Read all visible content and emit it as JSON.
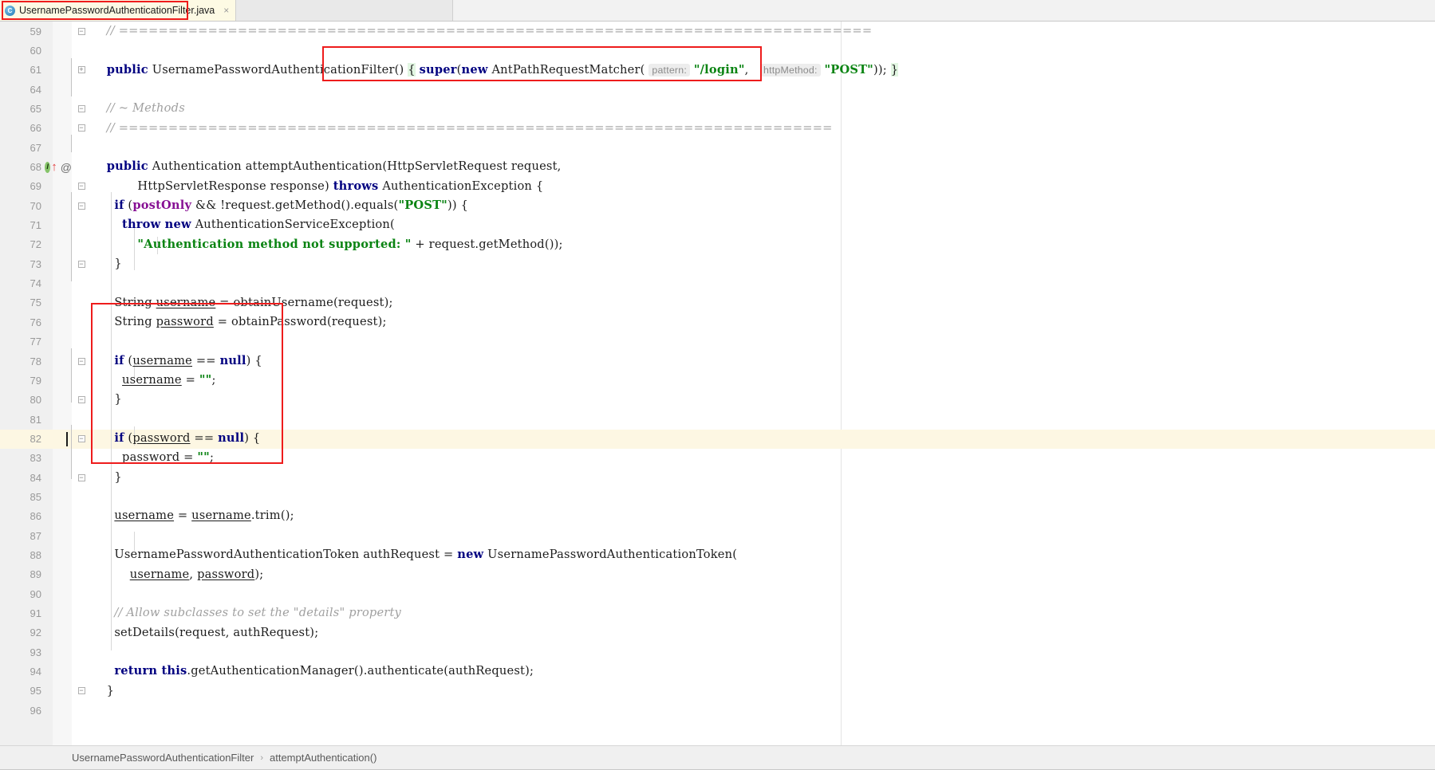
{
  "window": {
    "tab": {
      "filename": "UsernamePasswordAuthenticationFilter.java",
      "icon": "java-class-icon",
      "close_label": "×"
    }
  },
  "breadcrumb": {
    "items": [
      "UsernamePasswordAuthenticationFilter",
      "attemptAuthentication()"
    ],
    "separator": "›"
  },
  "editor": {
    "annotations": [
      {
        "name": "tab-highlight-box",
        "color": "#ee1c1c"
      },
      {
        "name": "constructor-highlight-box",
        "color": "#ee1c1c"
      },
      {
        "name": "null-check-highlight-box",
        "color": "#ee1c1c"
      }
    ],
    "caret_line": 81,
    "caret_line_color": "#fdf7e3",
    "colors": {
      "keyword": "#000080",
      "string": "#0b8413",
      "comment": "#a0a0a0",
      "field": "#871094",
      "hint_bg": "#ededed",
      "gutter_bg": "#f0f0f0"
    },
    "lines": [
      {
        "n": "59",
        "fold": "minus",
        "segments": [
          {
            "t": "  // ============================================================================",
            "c": "cmt"
          }
        ]
      },
      {
        "n": "60",
        "segments": []
      },
      {
        "n": "61",
        "fold": "plus",
        "segments": [
          {
            "t": "  ",
            "c": ""
          },
          {
            "t": "public",
            "c": "kw"
          },
          {
            "t": " UsernamePasswordAuthenticationFilter() ",
            "c": ""
          },
          {
            "t": "{",
            "c": "hl-brace"
          },
          {
            "t": " ",
            "c": ""
          },
          {
            "t": "super",
            "c": "kw"
          },
          {
            "t": "(",
            "c": ""
          },
          {
            "t": "new",
            "c": "kw"
          },
          {
            "t": " AntPathRequestMatcher( ",
            "c": ""
          },
          {
            "t": "pattern:",
            "c": "hint"
          },
          {
            "t": " ",
            "c": ""
          },
          {
            "t": "\"/login\"",
            "c": "str"
          },
          {
            "t": ",   ",
            "c": ""
          },
          {
            "t": "httpMethod:",
            "c": "hint"
          },
          {
            "t": " ",
            "c": ""
          },
          {
            "t": "\"POST\"",
            "c": "str"
          },
          {
            "t": ")); ",
            "c": ""
          },
          {
            "t": "}",
            "c": "hl-brace"
          }
        ]
      },
      {
        "n": "64",
        "segments": []
      },
      {
        "n": "65",
        "fold": "minus",
        "segments": [
          {
            "t": "  // ~ Methods",
            "c": "cmt"
          }
        ]
      },
      {
        "n": "66",
        "fold": "minus",
        "segments": [
          {
            "t": "  // ========================================================================",
            "c": "cmt"
          }
        ]
      },
      {
        "n": "67",
        "segments": []
      },
      {
        "n": "68",
        "icons": [
          "implementing-method-icon",
          "override-arrow-icon",
          "annotation-icon"
        ],
        "segments": [
          {
            "t": "  ",
            "c": ""
          },
          {
            "t": "public",
            "c": "kw"
          },
          {
            "t": " Authentication attemptAuthentication(HttpServletRequest request,",
            "c": ""
          }
        ]
      },
      {
        "n": "69",
        "fold": "minus",
        "segments": [
          {
            "t": "          HttpServletResponse response) ",
            "c": ""
          },
          {
            "t": "throws",
            "c": "kw"
          },
          {
            "t": " AuthenticationException {",
            "c": ""
          }
        ]
      },
      {
        "n": "70",
        "fold": "minus",
        "segments": [
          {
            "t": "    ",
            "c": ""
          },
          {
            "t": "if",
            "c": "kw"
          },
          {
            "t": " (",
            "c": ""
          },
          {
            "t": "postOnly",
            "c": "fld"
          },
          {
            "t": " && !request.getMethod().equals(",
            "c": ""
          },
          {
            "t": "\"POST\"",
            "c": "str"
          },
          {
            "t": ")) {",
            "c": ""
          }
        ]
      },
      {
        "n": "71",
        "segments": [
          {
            "t": "      ",
            "c": ""
          },
          {
            "t": "throw new",
            "c": "kw"
          },
          {
            "t": " AuthenticationServiceException(",
            "c": ""
          }
        ]
      },
      {
        "n": "72",
        "segments": [
          {
            "t": "          ",
            "c": ""
          },
          {
            "t": "\"Authentication method not supported: \"",
            "c": "str"
          },
          {
            "t": " + request.getMethod());",
            "c": ""
          }
        ]
      },
      {
        "n": "73",
        "fold": "minus",
        "segments": [
          {
            "t": "    }",
            "c": ""
          }
        ]
      },
      {
        "n": "74",
        "segments": []
      },
      {
        "n": "75",
        "segments": [
          {
            "t": "    String ",
            "c": ""
          },
          {
            "t": "username",
            "c": "loc"
          },
          {
            "t": " = obtainUsername(request);",
            "c": ""
          }
        ]
      },
      {
        "n": "76",
        "segments": [
          {
            "t": "    String ",
            "c": ""
          },
          {
            "t": "password",
            "c": "loc"
          },
          {
            "t": " = obtainPassword(request);",
            "c": ""
          }
        ]
      },
      {
        "n": "77",
        "segments": []
      },
      {
        "n": "78",
        "fold": "minus",
        "segments": [
          {
            "t": "    ",
            "c": ""
          },
          {
            "t": "if",
            "c": "kw"
          },
          {
            "t": " (",
            "c": ""
          },
          {
            "t": "username",
            "c": "loc"
          },
          {
            "t": " == ",
            "c": ""
          },
          {
            "t": "null",
            "c": "kw"
          },
          {
            "t": ") {",
            "c": ""
          }
        ]
      },
      {
        "n": "79",
        "segments": [
          {
            "t": "      ",
            "c": ""
          },
          {
            "t": "username",
            "c": "loc"
          },
          {
            "t": " = ",
            "c": ""
          },
          {
            "t": "\"\"",
            "c": "str"
          },
          {
            "t": ";",
            "c": ""
          }
        ]
      },
      {
        "n": "80",
        "fold": "minus",
        "segments": [
          {
            "t": "    }",
            "c": ""
          }
        ]
      },
      {
        "n": "81",
        "segments": []
      },
      {
        "n": "82",
        "fold": "minus",
        "segments": [
          {
            "t": "    ",
            "c": ""
          },
          {
            "t": "if",
            "c": "kw"
          },
          {
            "t": " (",
            "c": ""
          },
          {
            "t": "password",
            "c": "loc"
          },
          {
            "t": " == ",
            "c": ""
          },
          {
            "t": "null",
            "c": "kw"
          },
          {
            "t": ") {",
            "c": ""
          }
        ]
      },
      {
        "n": "83",
        "segments": [
          {
            "t": "      ",
            "c": ""
          },
          {
            "t": "password",
            "c": "loc"
          },
          {
            "t": " = ",
            "c": ""
          },
          {
            "t": "\"\"",
            "c": "str"
          },
          {
            "t": ";",
            "c": ""
          }
        ]
      },
      {
        "n": "84",
        "fold": "minus",
        "segments": [
          {
            "t": "    }",
            "c": ""
          }
        ]
      },
      {
        "n": "85",
        "segments": []
      },
      {
        "n": "86",
        "segments": [
          {
            "t": "    ",
            "c": ""
          },
          {
            "t": "username",
            "c": "loc"
          },
          {
            "t": " = ",
            "c": ""
          },
          {
            "t": "username",
            "c": "loc"
          },
          {
            "t": ".trim();",
            "c": ""
          }
        ]
      },
      {
        "n": "87",
        "segments": []
      },
      {
        "n": "88",
        "segments": [
          {
            "t": "    UsernamePasswordAuthenticationToken authRequest = ",
            "c": ""
          },
          {
            "t": "new",
            "c": "kw"
          },
          {
            "t": " UsernamePasswordAuthenticationToken(",
            "c": ""
          }
        ]
      },
      {
        "n": "89",
        "segments": [
          {
            "t": "        ",
            "c": ""
          },
          {
            "t": "username",
            "c": "loc"
          },
          {
            "t": ", ",
            "c": ""
          },
          {
            "t": "password",
            "c": "loc"
          },
          {
            "t": ");",
            "c": ""
          }
        ]
      },
      {
        "n": "90",
        "segments": []
      },
      {
        "n": "91",
        "segments": [
          {
            "t": "    // Allow subclasses to set the \"details\" property",
            "c": "cmt"
          }
        ]
      },
      {
        "n": "92",
        "segments": [
          {
            "t": "    setDetails(request, authRequest);",
            "c": ""
          }
        ]
      },
      {
        "n": "93",
        "segments": []
      },
      {
        "n": "94",
        "segments": [
          {
            "t": "    ",
            "c": ""
          },
          {
            "t": "return this",
            "c": "kw"
          },
          {
            "t": ".getAuthenticationManager().authenticate(authRequest);",
            "c": ""
          }
        ]
      },
      {
        "n": "95",
        "fold": "minus",
        "segments": [
          {
            "t": "  }",
            "c": ""
          }
        ]
      },
      {
        "n": "96",
        "segments": []
      }
    ]
  }
}
